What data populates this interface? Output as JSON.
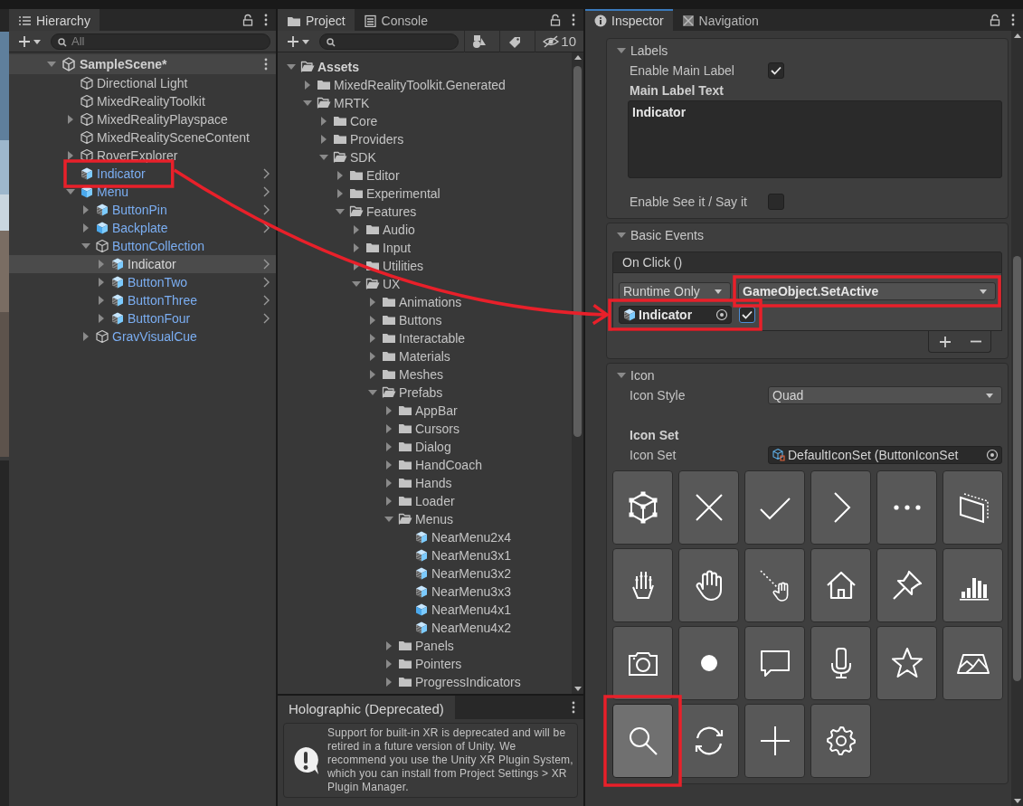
{
  "hierarchy": {
    "title": "Hierarchy",
    "search_placeholder": "All",
    "scene": {
      "name": "SampleScene*",
      "expanded": true
    },
    "items": [
      {
        "name": "Directional Light",
        "kind": "object",
        "prefab": false,
        "selected": false
      },
      {
        "name": "MixedRealityToolkit",
        "kind": "object",
        "prefab": false,
        "selected": false
      },
      {
        "name": "MixedRealityPlayspace",
        "kind": "object",
        "prefab": false,
        "selected": false,
        "expanded": false
      },
      {
        "name": "MixedRealitySceneContent",
        "kind": "object",
        "prefab": false,
        "selected": false
      },
      {
        "name": "RoverExplorer",
        "kind": "object",
        "prefab": false,
        "selected": false,
        "expanded": false
      },
      {
        "name": "Indicator",
        "kind": "prefab_variant",
        "prefab": true,
        "selected": false,
        "open_arrow": true,
        "highlighted": true
      },
      {
        "name": "Menu",
        "kind": "prefab",
        "prefab": true,
        "selected": false,
        "open_arrow": true,
        "expanded": true,
        "children": [
          {
            "name": "ButtonPin",
            "kind": "prefab_variant",
            "prefab": true,
            "selected": false,
            "open_arrow": true,
            "expanded": false
          },
          {
            "name": "Backplate",
            "kind": "prefab",
            "prefab": true,
            "selected": false,
            "open_arrow": true,
            "expanded": false
          },
          {
            "name": "ButtonCollection",
            "kind": "object",
            "prefab": true,
            "selected": false,
            "expanded": true,
            "children": [
              {
                "name": "Indicator",
                "kind": "prefab_variant",
                "prefab": true,
                "selected": true,
                "open_arrow": true,
                "expanded": false
              },
              {
                "name": "ButtonTwo",
                "kind": "prefab_variant",
                "prefab": true,
                "selected": false,
                "open_arrow": true,
                "expanded": false
              },
              {
                "name": "ButtonThree",
                "kind": "prefab_variant",
                "prefab": true,
                "selected": false,
                "open_arrow": true,
                "expanded": false
              },
              {
                "name": "ButtonFour",
                "kind": "prefab_variant",
                "prefab": true,
                "selected": false,
                "open_arrow": true,
                "expanded": false
              }
            ]
          },
          {
            "name": "GravVisualCue",
            "kind": "object",
            "prefab": true,
            "selected": false,
            "expanded": false
          }
        ]
      }
    ]
  },
  "project": {
    "tabs": [
      {
        "label": "Project",
        "kind": "project",
        "selected": true
      },
      {
        "label": "Console",
        "kind": "console",
        "selected": false
      }
    ],
    "hidden_count": "10",
    "items": [
      {
        "name": "Assets",
        "kind": "folder",
        "expanded": true,
        "children": [
          {
            "name": "MixedRealityToolkit.Generated",
            "kind": "folder",
            "expanded": false
          },
          {
            "name": "MRTK",
            "kind": "folder",
            "expanded": true,
            "children": [
              {
                "name": "Core",
                "kind": "folder",
                "expanded": false
              },
              {
                "name": "Providers",
                "kind": "folder",
                "expanded": false
              },
              {
                "name": "SDK",
                "kind": "folder",
                "expanded": true,
                "children": [
                  {
                    "name": "Editor",
                    "kind": "folder",
                    "expanded": false
                  },
                  {
                    "name": "Experimental",
                    "kind": "folder",
                    "expanded": false
                  },
                  {
                    "name": "Features",
                    "kind": "folder",
                    "expanded": true,
                    "children": [
                      {
                        "name": "Audio",
                        "kind": "folder",
                        "expanded": false
                      },
                      {
                        "name": "Input",
                        "kind": "folder",
                        "expanded": false
                      },
                      {
                        "name": "Utilities",
                        "kind": "folder",
                        "expanded": false
                      },
                      {
                        "name": "UX",
                        "kind": "folder",
                        "expanded": true,
                        "children": [
                          {
                            "name": "Animations",
                            "kind": "folder",
                            "expanded": false
                          },
                          {
                            "name": "Buttons",
                            "kind": "folder",
                            "expanded": false
                          },
                          {
                            "name": "Interactable",
                            "kind": "folder",
                            "expanded": false
                          },
                          {
                            "name": "Materials",
                            "kind": "folder",
                            "expanded": false
                          },
                          {
                            "name": "Meshes",
                            "kind": "folder",
                            "expanded": false
                          },
                          {
                            "name": "Prefabs",
                            "kind": "folder",
                            "expanded": true,
                            "children": [
                              {
                                "name": "AppBar",
                                "kind": "folder",
                                "expanded": false
                              },
                              {
                                "name": "Cursors",
                                "kind": "folder",
                                "expanded": false
                              },
                              {
                                "name": "Dialog",
                                "kind": "folder",
                                "expanded": false
                              },
                              {
                                "name": "HandCoach",
                                "kind": "folder",
                                "expanded": false
                              },
                              {
                                "name": "Hands",
                                "kind": "folder",
                                "expanded": false
                              },
                              {
                                "name": "Loader",
                                "kind": "folder",
                                "expanded": false
                              },
                              {
                                "name": "Menus",
                                "kind": "folder",
                                "expanded": true,
                                "children": [
                                  {
                                    "name": "NearMenu2x4",
                                    "kind": "prefab_variant"
                                  },
                                  {
                                    "name": "NearMenu3x1",
                                    "kind": "prefab_variant"
                                  },
                                  {
                                    "name": "NearMenu3x2",
                                    "kind": "prefab_variant"
                                  },
                                  {
                                    "name": "NearMenu3x3",
                                    "kind": "prefab_variant"
                                  },
                                  {
                                    "name": "NearMenu4x1",
                                    "kind": "prefab"
                                  },
                                  {
                                    "name": "NearMenu4x2",
                                    "kind": "prefab_variant"
                                  }
                                ]
                              },
                              {
                                "name": "Panels",
                                "kind": "folder",
                                "expanded": false
                              },
                              {
                                "name": "Pointers",
                                "kind": "folder",
                                "expanded": false
                              },
                              {
                                "name": "ProgressIndicators",
                                "kind": "folder",
                                "expanded": false
                              }
                            ]
                          }
                        ]
                      }
                    ]
                  }
                ]
              }
            ]
          }
        ]
      }
    ]
  },
  "holographic": {
    "title": "Holographic (Deprecated)",
    "message": "Support for built-in XR is deprecated and will be retired in a future version of Unity. We recommend you use the Unity XR Plugin System, which you can install from Project Settings > XR Plugin Manager."
  },
  "inspector": {
    "tabs": [
      {
        "label": "Inspector",
        "kind": "inspector",
        "selected": true
      },
      {
        "label": "Navigation",
        "kind": "navigation",
        "selected": false
      }
    ],
    "sections": [
      {
        "title": "Labels",
        "expanded": true,
        "fields": [
          {
            "kind": "checkbox",
            "label": "Enable Main Label",
            "checked": true
          },
          {
            "kind": "heading",
            "text": "Main Label Text"
          },
          {
            "kind": "textarea",
            "value": "Indicator"
          },
          {
            "kind": "checkbox",
            "label": "Enable See it / Say it",
            "checked": false
          }
        ]
      },
      {
        "title": "Basic Events",
        "expanded": true,
        "fields": [
          {
            "kind": "event",
            "header": "On Click ()",
            "mode": "Runtime Only",
            "function": {
              "value": "GameObject.SetActive",
              "highlighted": true
            },
            "target": {
              "value": "Indicator",
              "highlighted": true
            },
            "argument_checked": true
          }
        ]
      },
      {
        "title": "Icon",
        "expanded": true,
        "fields": [
          {
            "kind": "dropdown",
            "label": "Icon Style",
            "value": "Quad"
          },
          {
            "kind": "heading",
            "text": "Icon Set"
          },
          {
            "kind": "object",
            "label": "Icon Set",
            "value": "DefaultIconSet (ButtonIconSet"
          },
          {
            "kind": "icon_grid",
            "icons": [
              {
                "selected": false
              },
              {
                "selected": false
              },
              {
                "selected": false
              },
              {
                "selected": false
              },
              {
                "selected": false
              },
              {
                "selected": false
              },
              {
                "selected": false
              },
              {
                "selected": false
              },
              {
                "selected": false
              },
              {
                "selected": false
              },
              {
                "selected": false
              },
              {
                "selected": false
              },
              {
                "selected": false
              },
              {
                "selected": false
              },
              {
                "selected": false
              },
              {
                "selected": false
              },
              {
                "selected": false
              },
              {
                "selected": false
              },
              {
                "selected": true,
                "highlighted": true
              },
              {
                "selected": false
              },
              {
                "selected": false
              },
              {
                "selected": false
              }
            ]
          }
        ]
      }
    ]
  },
  "annotation_arrow": true
}
